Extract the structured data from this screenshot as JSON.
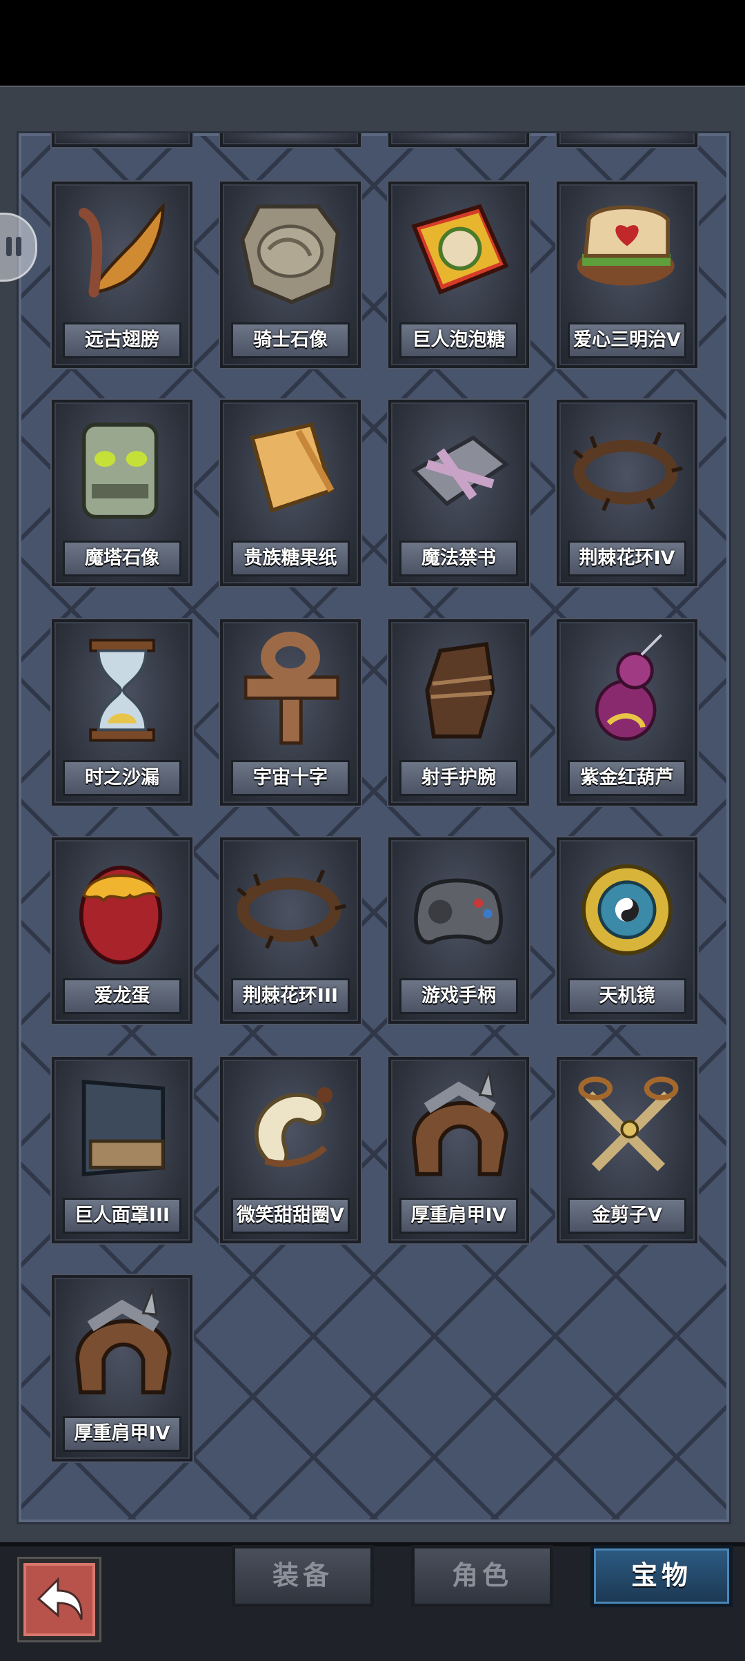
{
  "tabs": [
    {
      "label": "装备",
      "active": false
    },
    {
      "label": "角色",
      "active": false
    },
    {
      "label": "宝物",
      "active": true
    }
  ],
  "items": [
    {
      "label": "远古翅膀",
      "icon": "wing-icon"
    },
    {
      "label": "骑士石像",
      "icon": "stone-plate-icon"
    },
    {
      "label": "巨人泡泡糖",
      "icon": "gum-box-icon"
    },
    {
      "label": "爱心三明治V",
      "icon": "heart-sandwich-icon"
    },
    {
      "label": "魔塔石像",
      "icon": "totem-head-icon"
    },
    {
      "label": "贵族糖果纸",
      "icon": "candy-wrapper-icon"
    },
    {
      "label": "魔法禁书",
      "icon": "sealed-book-icon"
    },
    {
      "label": "荆棘花环IV",
      "icon": "thorn-wreath-icon"
    },
    {
      "label": "时之沙漏",
      "icon": "hourglass-icon"
    },
    {
      "label": "宇宙十字",
      "icon": "ankh-cross-icon"
    },
    {
      "label": "射手护腕",
      "icon": "bracer-icon"
    },
    {
      "label": "紫金红葫芦",
      "icon": "gourd-icon"
    },
    {
      "label": "爱龙蛋",
      "icon": "dragon-egg-icon"
    },
    {
      "label": "荆棘花环III",
      "icon": "thorn-wreath-icon"
    },
    {
      "label": "游戏手柄",
      "icon": "gamepad-icon"
    },
    {
      "label": "天机镜",
      "icon": "bagua-mirror-icon"
    },
    {
      "label": "巨人面罩III",
      "icon": "mask-icon"
    },
    {
      "label": "微笑甜甜圈V",
      "icon": "donut-icon"
    },
    {
      "label": "厚重肩甲IV",
      "icon": "pauldron-icon"
    },
    {
      "label": "金剪子V",
      "icon": "scissors-icon"
    },
    {
      "label": "厚重肩甲IV",
      "icon": "pauldron-icon"
    }
  ]
}
